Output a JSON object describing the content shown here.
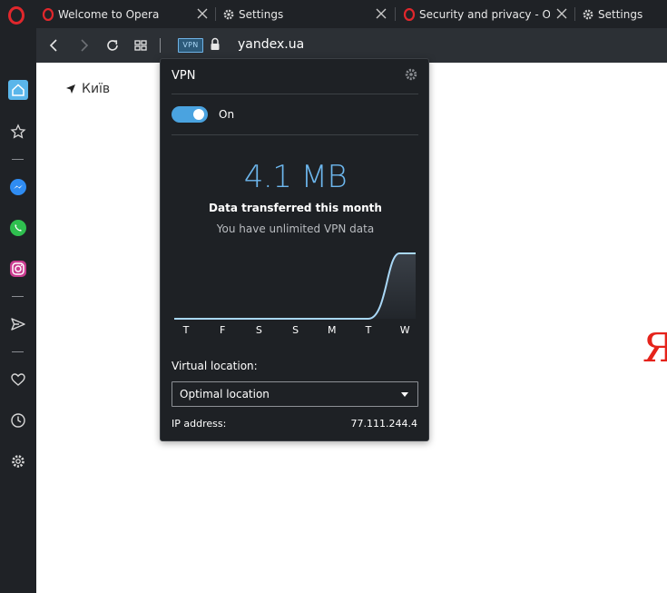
{
  "tabs": [
    {
      "title": "Welcome to Opera",
      "icon": "opera-icon"
    },
    {
      "title": "Settings",
      "icon": "gear-icon"
    },
    {
      "title": "Security and privacy - Opera",
      "icon": "opera-icon"
    },
    {
      "title": "Settings",
      "icon": "gear-icon"
    }
  ],
  "address": {
    "vpn_badge": "VPN",
    "url": "yandex.ua"
  },
  "sidebar": {
    "items": [
      "home-icon",
      "bookmarks-star-icon",
      "messenger-icon",
      "whatsapp-icon",
      "instagram-icon",
      "send-icon",
      "heart-icon",
      "history-clock-icon",
      "settings-gear-icon"
    ]
  },
  "page": {
    "location": "Київ",
    "logo_char": "Я"
  },
  "vpn_popup": {
    "title": "VPN",
    "toggle_label": "On",
    "toggle_on": true,
    "data_amount": "4.1 MB",
    "data_caption": "Data transferred this month",
    "unlimited_note": "You have unlimited VPN data",
    "days": [
      "T",
      "F",
      "S",
      "S",
      "M",
      "T",
      "W"
    ],
    "usage_mb": [
      0,
      0,
      0,
      0,
      0,
      0,
      4.1
    ],
    "virtual_location_label": "Virtual location:",
    "virtual_location_value": "Optimal location",
    "ip_label": "IP address:",
    "ip_value": "77.111.244.4"
  },
  "colors": {
    "accent": "#4aa3e0",
    "data_text": "#6db7ee",
    "opera_red": "#e0272c",
    "yandex_red": "#e5231b"
  }
}
